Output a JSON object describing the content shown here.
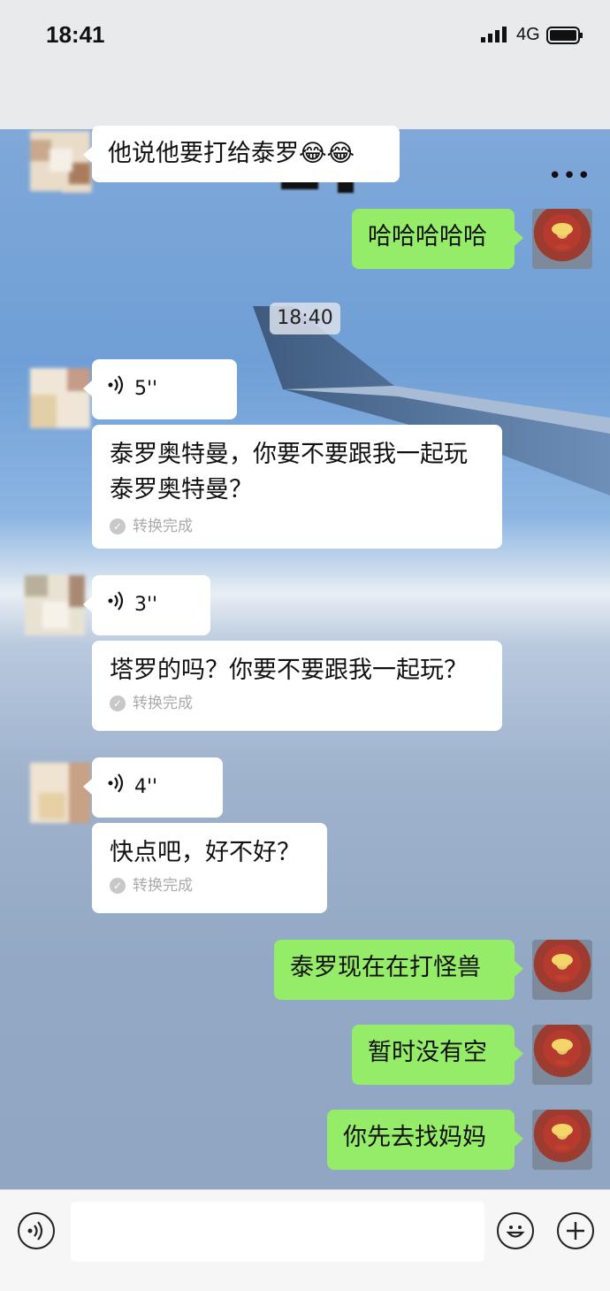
{
  "status": {
    "time": "18:41",
    "network": "4G"
  },
  "header": {
    "back_icon": "back-icon",
    "more": "•••"
  },
  "timestamp": "18:40",
  "messages": [
    {
      "side": "left",
      "text": "他说他要打给泰罗😂😂"
    },
    {
      "side": "right",
      "text": "哈哈哈哈哈"
    },
    {
      "side": "left",
      "voice": "5''",
      "transcript": "泰罗奥特曼，你要不要跟我一起玩\n泰罗奥特曼？",
      "status": "转换完成"
    },
    {
      "side": "left",
      "voice": "3''",
      "transcript": "塔罗的吗？你要不要跟我一起玩？",
      "status": "转换完成"
    },
    {
      "side": "left",
      "voice": "4''",
      "transcript": "快点吧，好不好？",
      "status": "转换完成"
    },
    {
      "side": "right",
      "text": "泰罗现在在打怪兽"
    },
    {
      "side": "right",
      "text": "暂时没有空"
    },
    {
      "side": "right",
      "text": "你先去找妈妈"
    }
  ],
  "icons": {
    "voice": "voice-icon",
    "emoji": "emoji-icon",
    "add": "plus-icon"
  }
}
